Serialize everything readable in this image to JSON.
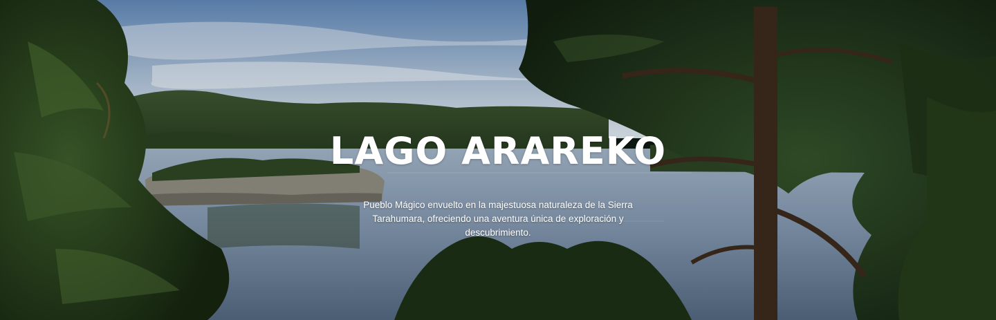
{
  "hero": {
    "title": "LAGO ARAREKO",
    "description": "Pueblo Mágico envuelto en la majestuosa naturaleza de la Sierra Tarahumara, ofreciendo una aventura única de exploración y descubrimiento."
  },
  "colors": {
    "sky_top": "#5f86b5",
    "sky_bottom": "#d9e2ea",
    "lake": "#7f93ab",
    "forest": "#2f4a26",
    "text": "#ffffff"
  }
}
